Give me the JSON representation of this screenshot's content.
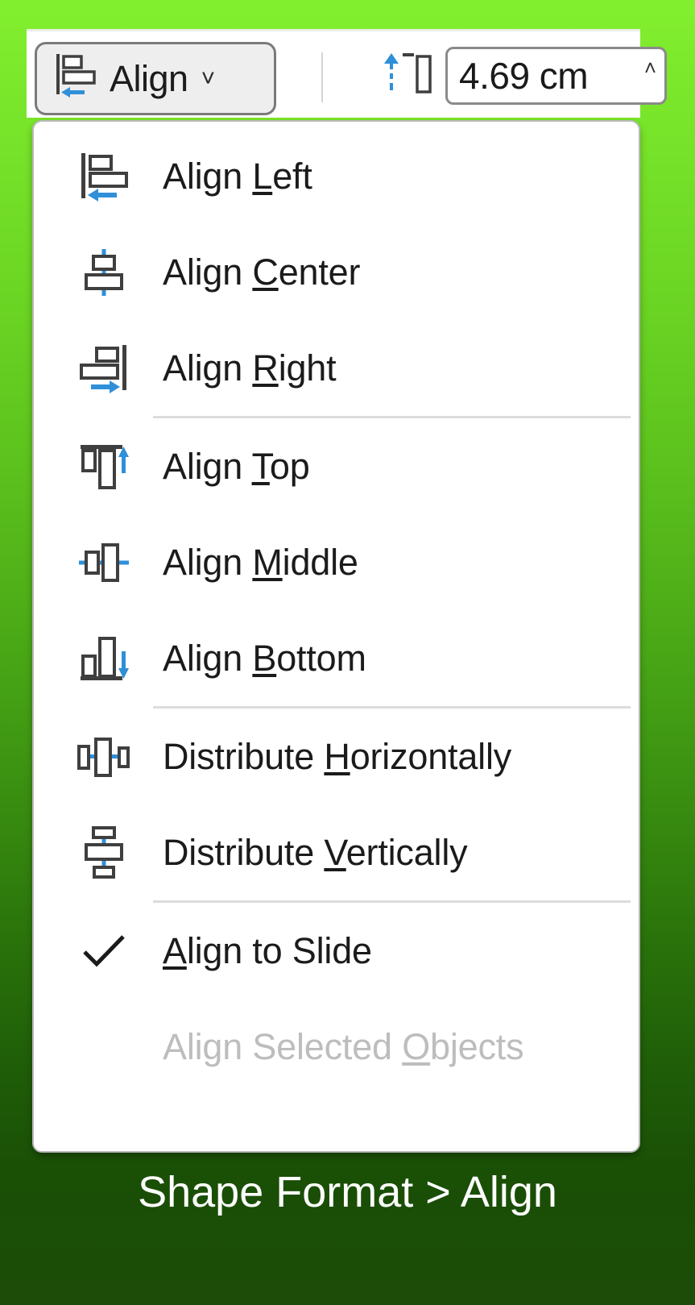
{
  "background": {
    "gradient_top": "#82ef2e",
    "gradient_bottom": "#1c4c07"
  },
  "ribbon": {
    "align_button": {
      "label": "Align",
      "icon": "align-left-icon",
      "dropdown_arrow": "˅"
    },
    "height_field": {
      "icon": "shape-height-icon",
      "value": "4.69 cm",
      "spinner": "˄"
    }
  },
  "menu": {
    "name": "align-dropdown-menu",
    "items": [
      {
        "id": "align-left",
        "label_pre": "Align ",
        "accel": "L",
        "label_post": "eft",
        "icon": "align-left-icon",
        "state": "enabled",
        "checked": false
      },
      {
        "id": "align-center",
        "label_pre": "Align ",
        "accel": "C",
        "label_post": "enter",
        "icon": "align-center-icon",
        "state": "enabled",
        "checked": false
      },
      {
        "id": "align-right",
        "label_pre": "Align ",
        "accel": "R",
        "label_post": "ight",
        "icon": "align-right-icon",
        "state": "enabled",
        "checked": false
      },
      {
        "id": "separator-1",
        "type": "separator"
      },
      {
        "id": "align-top",
        "label_pre": "Align ",
        "accel": "T",
        "label_post": "op",
        "icon": "align-top-icon",
        "state": "enabled",
        "checked": false
      },
      {
        "id": "align-middle",
        "label_pre": "Align ",
        "accel": "M",
        "label_post": "iddle",
        "icon": "align-middle-icon",
        "state": "enabled",
        "checked": false
      },
      {
        "id": "align-bottom",
        "label_pre": "Align ",
        "accel": "B",
        "label_post": "ottom",
        "icon": "align-bottom-icon",
        "state": "enabled",
        "checked": false
      },
      {
        "id": "separator-2",
        "type": "separator"
      },
      {
        "id": "distribute-horizontally",
        "label_pre": "Distribute ",
        "accel": "H",
        "label_post": "orizontally",
        "icon": "distribute-horizontally-icon",
        "state": "enabled",
        "checked": false
      },
      {
        "id": "distribute-vertically",
        "label_pre": "Distribute ",
        "accel": "V",
        "label_post": "ertically",
        "icon": "distribute-vertically-icon",
        "state": "enabled",
        "checked": false
      },
      {
        "id": "separator-3",
        "type": "separator"
      },
      {
        "id": "align-to-slide",
        "label_pre": "",
        "accel": "A",
        "label_post": "lign to Slide",
        "icon": "check-icon",
        "state": "enabled",
        "checked": true
      },
      {
        "id": "align-selected-objects",
        "label_pre": "Align Selected ",
        "accel": "O",
        "label_post": "bjects",
        "icon": "none",
        "state": "disabled",
        "checked": false
      }
    ]
  },
  "caption": {
    "text": "Shape Format > Align",
    "color": "#ffffff"
  },
  "colors": {
    "icon_outline": "#3f3f3f",
    "icon_accent_blue": "#2f8fd8",
    "menu_background": "#ffffff",
    "separator": "#dcdcdc",
    "disabled_text": "#bdbdbd",
    "text": "#1b1b1b"
  }
}
